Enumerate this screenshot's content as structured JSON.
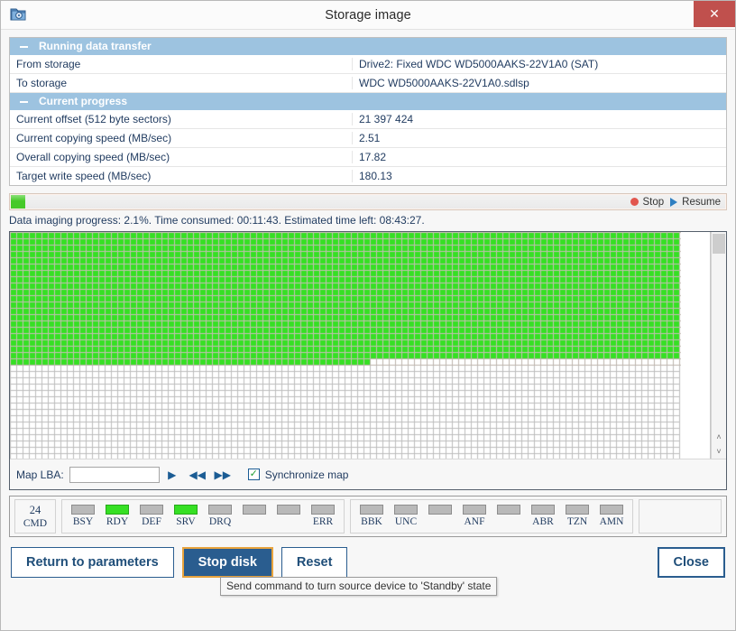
{
  "window": {
    "title": "Storage image",
    "icon": "disk-folder-icon",
    "close_label": "✕"
  },
  "sections": [
    {
      "header": "Running data transfer",
      "collapse_indicator": "−",
      "rows": [
        {
          "label": "From storage",
          "value": "Drive2: Fixed WDC WD5000AAKS-22V1A0 (SAT)"
        },
        {
          "label": "To storage",
          "value": "WDC WD5000AAKS-22V1A0.sdlsp"
        }
      ]
    },
    {
      "header": "Current progress",
      "collapse_indicator": "−",
      "rows": [
        {
          "label": "Current offset (512 byte sectors)",
          "value": "21 397 424"
        },
        {
          "label": "Current copying speed (MB/sec)",
          "value": "2.51"
        },
        {
          "label": "Overall copying speed (MB/sec)",
          "value": "17.82"
        },
        {
          "label": "Target write speed (MB/sec)",
          "value": "180.13"
        }
      ]
    }
  ],
  "progress": {
    "percent": 2.1,
    "fill_color": "#46c928",
    "stop_label": "Stop",
    "resume_label": "Resume",
    "status_text": "Data imaging progress: 2.1%. Time consumed: 00:11:43. Estimated time left: 08:43:27."
  },
  "map": {
    "columns": 105,
    "rows": 40,
    "cell_pitch": 7,
    "filled_cells": 2177,
    "done_color": "#36e024",
    "empty_color": "#ffffff",
    "grid_color": "#bdbdbd",
    "scrollbar": {
      "thumb_position": "top",
      "up_arrow": "˄",
      "down_arrow": "˅"
    }
  },
  "map_toolbar": {
    "lba_label": "Map LBA:",
    "lba_value": "",
    "lba_placeholder": "",
    "go_icon": "▶",
    "prev_icon": "◀◀",
    "next_icon": "▶▶",
    "sync_checked": true,
    "sync_check_glyph": "✓",
    "sync_label": "Synchronize map"
  },
  "registers": {
    "command": {
      "value": "24",
      "label": "CMD"
    },
    "status_bits": [
      {
        "label": "BSY",
        "on": false
      },
      {
        "label": "RDY",
        "on": true
      },
      {
        "label": "DEF",
        "on": false
      },
      {
        "label": "SRV",
        "on": true
      },
      {
        "label": "DRQ",
        "on": false
      },
      {
        "label": "",
        "on": false
      },
      {
        "label": "",
        "on": false
      },
      {
        "label": "ERR",
        "on": false
      }
    ],
    "error_bits": [
      {
        "label": "BBK",
        "on": false
      },
      {
        "label": "UNC",
        "on": false
      },
      {
        "label": "",
        "on": false
      },
      {
        "label": "ANF",
        "on": false
      },
      {
        "label": "",
        "on": false
      },
      {
        "label": "ABR",
        "on": false
      },
      {
        "label": "TZN",
        "on": false
      },
      {
        "label": "AMN",
        "on": false
      }
    ]
  },
  "footer": {
    "return_label": "Return to parameters",
    "stop_disk_label": "Stop disk",
    "reset_label": "Reset",
    "close_label": "Close",
    "tooltip": "Send command to turn source device to 'Standby' state"
  }
}
